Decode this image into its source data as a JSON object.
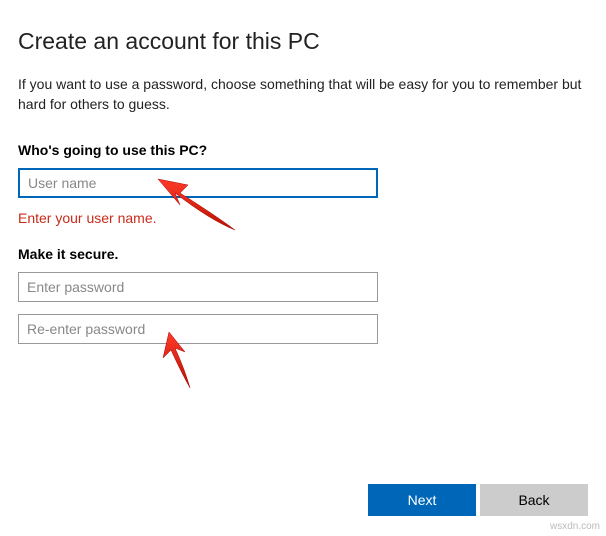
{
  "title": "Create an account for this PC",
  "description": "If you want to use a password, choose something that will be easy for you to remember but hard for others to guess.",
  "username_section": {
    "label": "Who's going to use this PC?",
    "placeholder": "User name",
    "error": "Enter your user name."
  },
  "password_section": {
    "label": "Make it secure.",
    "password_placeholder": "Enter password",
    "confirm_placeholder": "Re-enter password"
  },
  "buttons": {
    "next": "Next",
    "back": "Back"
  },
  "watermark": "wsxdn.com"
}
